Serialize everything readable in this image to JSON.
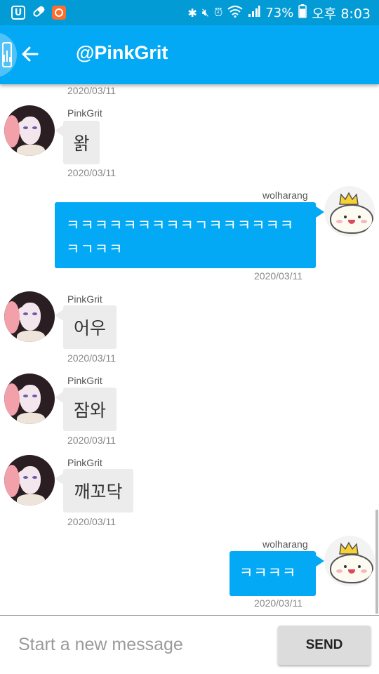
{
  "status_bar": {
    "battery": "73%",
    "time": "오후 8:03",
    "left_icons": [
      "app-u-icon",
      "pill-icon",
      "camera-app-icon"
    ],
    "right_icons": [
      "bluetooth-icon",
      "mute-icon",
      "alarm-icon",
      "wifi-icon",
      "signal-icon",
      "battery-icon"
    ]
  },
  "app_bar": {
    "title": "@PinkGrit",
    "color": "#03A9F4"
  },
  "messages": [
    {
      "direction": "incoming",
      "sender": "",
      "text": "",
      "date": "2020/03/11"
    },
    {
      "direction": "incoming",
      "sender": "PinkGrit",
      "text": "왉",
      "date": "2020/03/11"
    },
    {
      "direction": "outgoing",
      "sender": "wolharang",
      "text": "ㅋㅋㅋㅋㅋㅋㅋㅋㅋㄱㅋㅋㅋㅋㅋㅋㅋㄱㅋㅋ",
      "date": "2020/03/11"
    },
    {
      "direction": "incoming",
      "sender": "PinkGrit",
      "text": "어우",
      "date": "2020/03/11"
    },
    {
      "direction": "incoming",
      "sender": "PinkGrit",
      "text": "잠와",
      "date": "2020/03/11"
    },
    {
      "direction": "incoming",
      "sender": "PinkGrit",
      "text": "깨꼬닥",
      "date": "2020/03/11"
    },
    {
      "direction": "outgoing",
      "sender": "wolharang",
      "text": "ㅋㅋㅋㅋ",
      "date": "2020/03/11"
    }
  ],
  "composer": {
    "placeholder": "Start a new message",
    "send_label": "SEND"
  },
  "colors": {
    "status_bar": "#029BD6",
    "outgoing_bubble": "#03A9F4",
    "incoming_bubble": "#ececec"
  }
}
